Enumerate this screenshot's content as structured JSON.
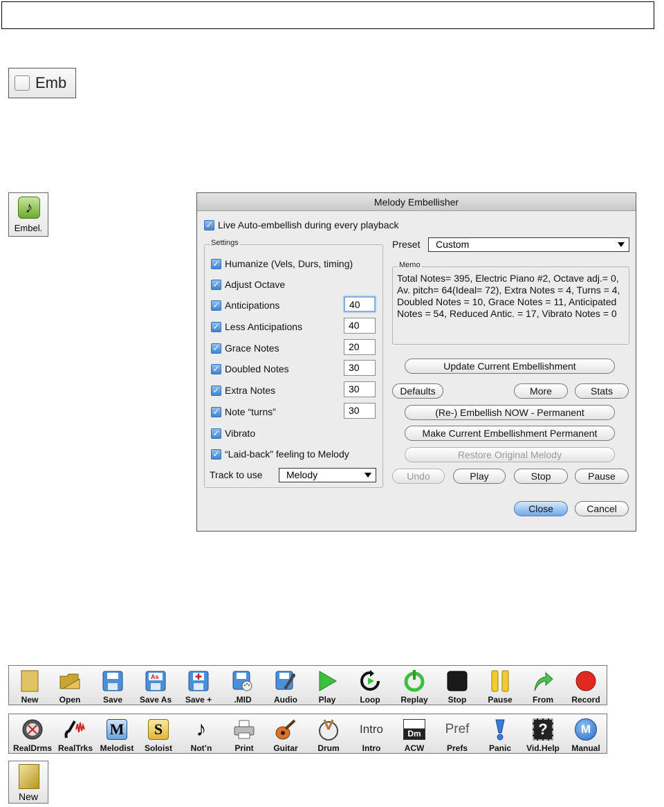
{
  "emb_toggle": {
    "label": "Emb",
    "checked": false
  },
  "embel_button": {
    "label": "Embel.",
    "icon": "music-note-icon"
  },
  "dialog": {
    "title": "Melody Embellisher",
    "live_auto": "Live Auto-embellish during every playback",
    "settings_label": "Settings",
    "settings": [
      {
        "label": "Humanize (Vels, Durs, timing)",
        "checked": true
      },
      {
        "label": "Adjust Octave",
        "checked": true
      },
      {
        "label": "Anticipations",
        "checked": true,
        "value": "40"
      },
      {
        "label": "Less Anticipations",
        "checked": true,
        "value": "40"
      },
      {
        "label": "Grace Notes",
        "checked": true,
        "value": "20"
      },
      {
        "label": "Doubled Notes",
        "checked": true,
        "value": "30"
      },
      {
        "label": "Extra Notes",
        "checked": true,
        "value": "30"
      },
      {
        "label": "Note “turns”",
        "checked": true,
        "value": "30"
      },
      {
        "label": "Vibrato",
        "checked": true
      },
      {
        "label": "“Laid-back” feeling to Melody",
        "checked": true
      }
    ],
    "track_label": "Track to use",
    "track_value": "Melody",
    "preset_label": "Preset",
    "preset_value": "Custom",
    "memo_label": "Memo",
    "memo_text": "Total Notes= 395,  Electric Piano #2, Octave adj.= 0, Av. pitch= 64(Ideal= 72), Extra Notes = 4,  Turns = 4,  Doubled  Notes = 10,  Grace Notes = 11,  Anticipated Notes = 54,  Reduced Antic. = 17,  Vibrato Notes = 0",
    "buttons": {
      "update": "Update Current Embellishment",
      "defaults": "Defaults",
      "more": "More",
      "stats": "Stats",
      "embellish_now": "(Re-) Embellish NOW - Permanent",
      "make_permanent": "Make Current Embellishment Permanent",
      "restore": "Restore Original Melody",
      "undo": "Undo",
      "play": "Play",
      "stop": "Stop",
      "pause": "Pause",
      "close": "Close",
      "cancel": "Cancel"
    }
  },
  "toolbar1": [
    {
      "label": "New",
      "icon": "new-file-icon"
    },
    {
      "label": "Open",
      "icon": "open-folder-icon"
    },
    {
      "label": "Save",
      "icon": "save-disk-icon"
    },
    {
      "label": "Save As",
      "icon": "save-as-icon"
    },
    {
      "label": "Save +",
      "icon": "save-plus-icon"
    },
    {
      "label": ".MID",
      "icon": "midi-file-icon"
    },
    {
      "label": "Audio",
      "icon": "audio-file-icon"
    },
    {
      "label": "Play",
      "icon": "play-icon"
    },
    {
      "label": "Loop",
      "icon": "loop-icon"
    },
    {
      "label": "Replay",
      "icon": "replay-icon"
    },
    {
      "label": "Stop",
      "icon": "stop-icon"
    },
    {
      "label": "Pause",
      "icon": "pause-icon"
    },
    {
      "label": "From",
      "icon": "from-arrow-icon"
    },
    {
      "label": "Record",
      "icon": "record-icon"
    }
  ],
  "toolbar2": [
    {
      "label": "RealDrms",
      "icon": "real-drums-icon"
    },
    {
      "label": "RealTrks",
      "icon": "real-tracks-icon"
    },
    {
      "label": "Melodist",
      "icon": "melodist-icon",
      "glyph": "M"
    },
    {
      "label": "Soloist",
      "icon": "soloist-icon",
      "glyph": "S"
    },
    {
      "label": "Not’n",
      "icon": "notation-icon"
    },
    {
      "label": "Print",
      "icon": "printer-icon"
    },
    {
      "label": "Guitar",
      "icon": "guitar-icon"
    },
    {
      "label": "Drum",
      "icon": "drum-icon"
    },
    {
      "label": "Intro",
      "icon": "intro-icon",
      "glyph": "Intro"
    },
    {
      "label": "ACW",
      "icon": "acw-icon",
      "glyph": "Dm"
    },
    {
      "label": "Prefs",
      "icon": "prefs-icon",
      "glyph": "Pref"
    },
    {
      "label": "Panic",
      "icon": "panic-icon"
    },
    {
      "label": "Vid.Help",
      "icon": "video-help-icon",
      "glyph": "?"
    },
    {
      "label": "Manual",
      "icon": "manual-icon",
      "glyph": "M"
    }
  ],
  "new_button": {
    "label": "New",
    "icon": "new-file-icon"
  },
  "colors": {
    "accent": "#3f84d6",
    "record": "#d9231b",
    "play": "#3aa83a"
  }
}
